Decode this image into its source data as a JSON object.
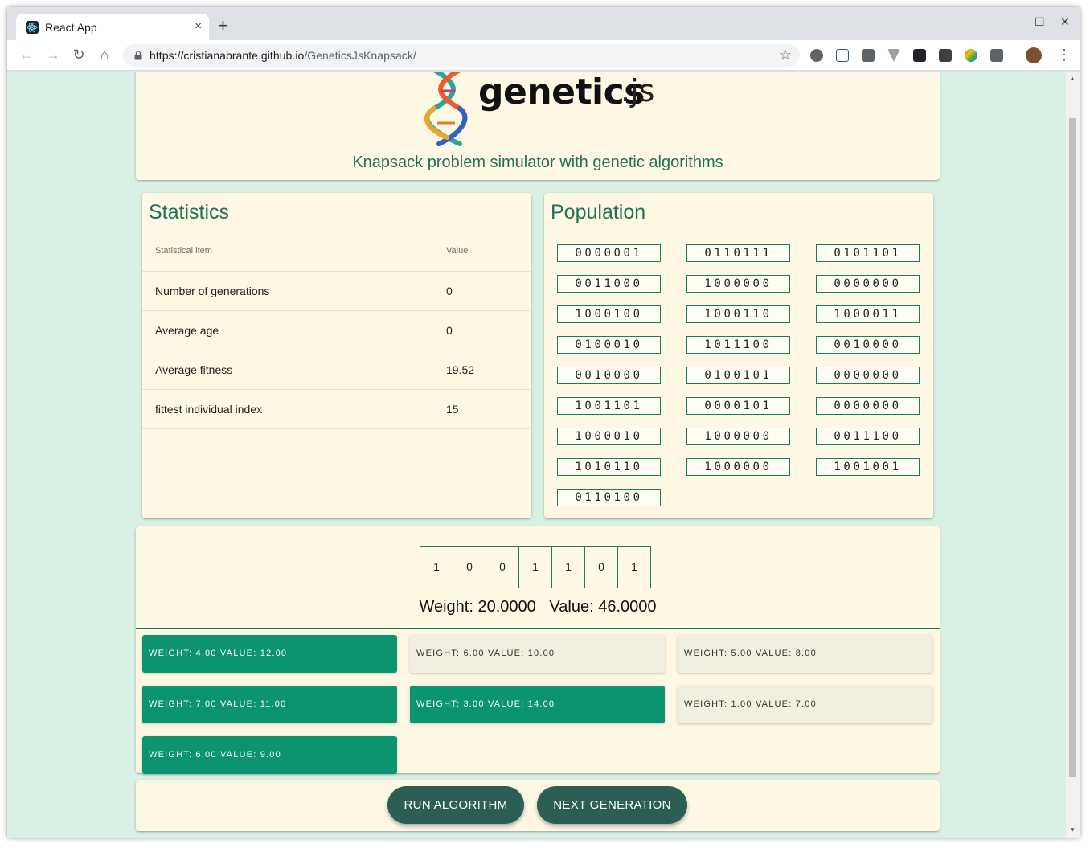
{
  "browser": {
    "tab_title": "React App",
    "tab_close": "×",
    "new_tab": "+",
    "url_host": "https://cristianabrante.github.io",
    "url_path": "/GeneticsJsKnapsack/",
    "win_minimize": "—",
    "win_maximize": "☐",
    "win_close": "✕"
  },
  "header": {
    "logo_text": "genetics",
    "logo_suffix": ".js",
    "subtitle": "Knapsack problem simulator with genetic algorithms"
  },
  "statistics": {
    "title": "Statistics",
    "col_item": "Statistical item",
    "col_value": "Value",
    "rows": [
      {
        "label": "Number of generations",
        "value": "0"
      },
      {
        "label": "Average age",
        "value": "0"
      },
      {
        "label": "Average fitness",
        "value": "19.52"
      },
      {
        "label": "fittest individual index",
        "value": "15"
      }
    ]
  },
  "population": {
    "title": "Population",
    "chromosomes": [
      "0000001",
      "0110111",
      "0101101",
      "0011000",
      "1000000",
      "0000000",
      "1000100",
      "1000110",
      "1000011",
      "0100010",
      "1011100",
      "0010000",
      "0010000",
      "0100101",
      "0000000",
      "1001101",
      "0000101",
      "0000000",
      "1000010",
      "1000000",
      "0011100",
      "1010110",
      "1000000",
      "1001001",
      "0110100"
    ]
  },
  "best": {
    "genes": [
      "1",
      "0",
      "0",
      "1",
      "1",
      "0",
      "1"
    ],
    "weight_value_text": "Weight: 20.0000   Value: 46.0000"
  },
  "items": [
    {
      "label": "Weight: 4.00 Value: 12.00",
      "selected": true
    },
    {
      "label": "Weight: 6.00 Value: 10.00",
      "selected": false
    },
    {
      "label": "Weight: 5.00 Value: 8.00",
      "selected": false
    },
    {
      "label": "Weight: 7.00 Value: 11.00",
      "selected": true
    },
    {
      "label": "Weight: 3.00 Value: 14.00",
      "selected": true
    },
    {
      "label": "Weight: 1.00 Value: 7.00",
      "selected": false
    },
    {
      "label": "Weight: 6.00 Value: 9.00",
      "selected": true
    }
  ],
  "actions": {
    "run_label": "RUN ALGORITHM",
    "next_label": "NEXT GENERATION"
  },
  "colors": {
    "accent": "#0b946f",
    "title_green": "#20705a",
    "card_bg": "#fdf7e4",
    "page_bg": "#d9f0e4",
    "button_bg": "#2b5f53"
  }
}
